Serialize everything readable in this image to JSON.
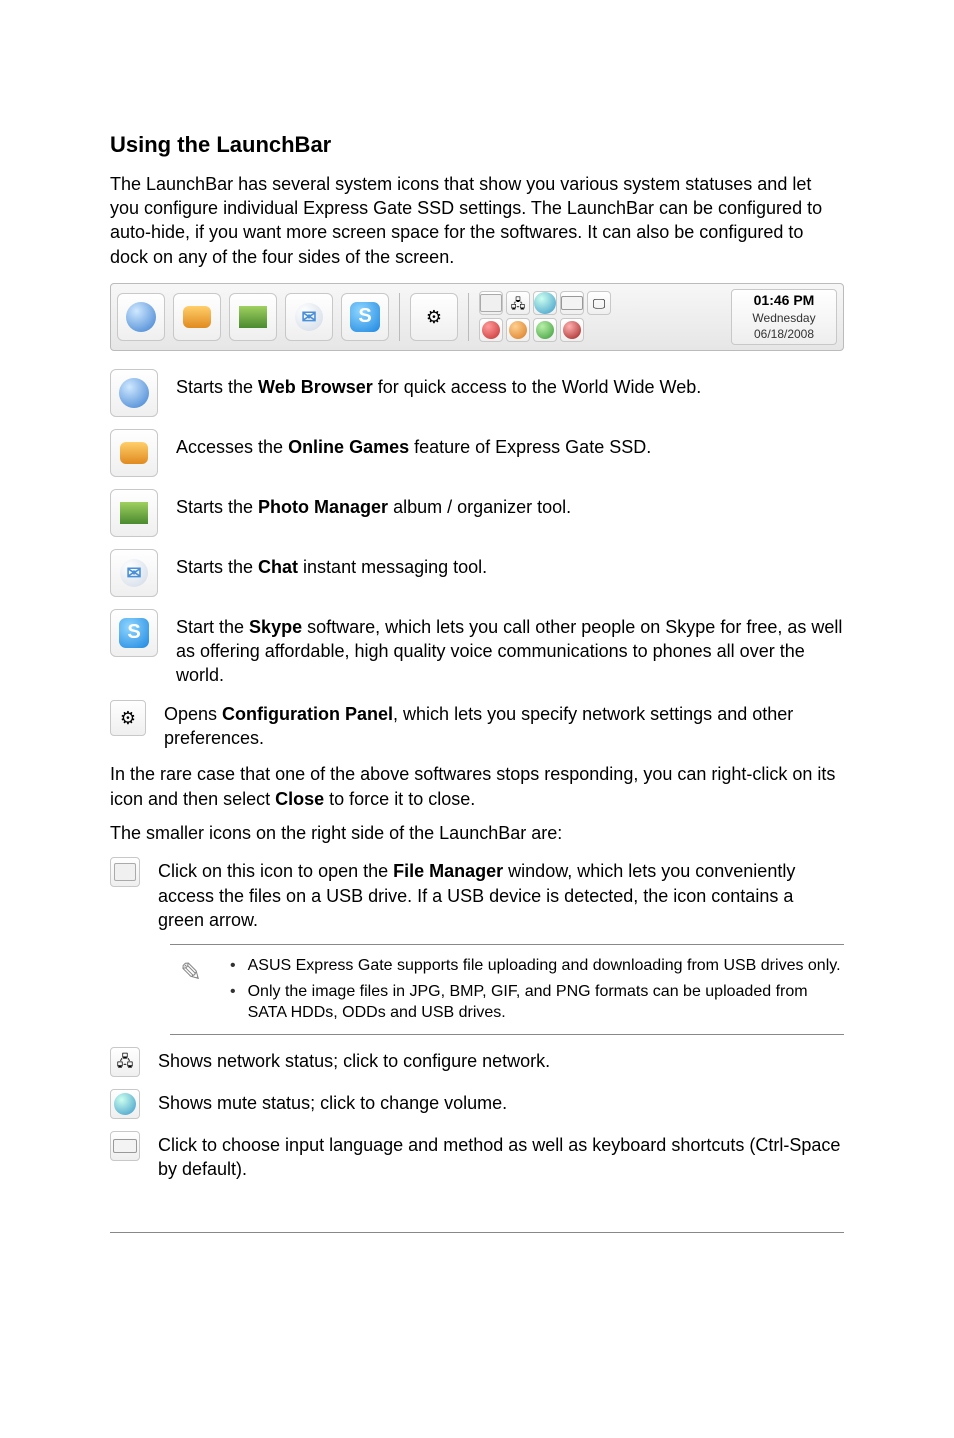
{
  "heading": "Using the LaunchBar",
  "intro": "The LaunchBar has several system icons that show you various system statuses and let you configure individual Express Gate SSD settings. The LaunchBar can be configured to auto-hide, if you want more screen space for the softwares. It can also be configured to dock on any of the four sides of the screen.",
  "launchbar": {
    "time": "01:46 PM",
    "day": "Wednesday",
    "date": "06/18/2008"
  },
  "items": [
    {
      "pre": "Starts the ",
      "bold": "Web Browser",
      "post": " for quick access to the World Wide Web."
    },
    {
      "pre": "Accesses the ",
      "bold": "Online Games",
      "post": " feature of Express Gate SSD."
    },
    {
      "pre": "Starts the ",
      "bold": "Photo Manager",
      "post": " album / organizer tool."
    },
    {
      "pre": "Starts the ",
      "bold": "Chat",
      "post": " instant messaging tool."
    },
    {
      "pre": "Start the ",
      "bold": "Skype",
      "post": " software, which lets you call other people on Skype for free, as well as offering affordable, high quality voice communications to phones all over the world."
    },
    {
      "pre": "Opens ",
      "bold": "Configuration Panel",
      "post": ", which lets you specify network settings and other preferences."
    }
  ],
  "mid1_pre": "In the rare case that one of the above softwares stops responding, you can right-click on its icon and then select ",
  "mid1_bold": "Close",
  "mid1_post": " to force it to close.",
  "mid2": "The smaller icons on the right side of the LaunchBar are:",
  "small": [
    {
      "pre": "Click on this icon to open the ",
      "bold": "File Manager",
      "post": " window, which lets you conveniently access the files on a USB drive. If a USB device is detected, the icon contains a green arrow."
    }
  ],
  "notes": [
    "ASUS Express Gate supports file uploading and downloading from USB drives only.",
    "Only the image files in JPG, BMP, GIF, and PNG formats can be uploaded from SATA HDDs, ODDs and USB drives."
  ],
  "small2": [
    {
      "text": "Shows network status; click to configure network."
    },
    {
      "text": "Shows mute status; click to change volume."
    },
    {
      "text": "Click to choose input language and method as well as keyboard shortcuts (Ctrl-Space by default)."
    }
  ]
}
